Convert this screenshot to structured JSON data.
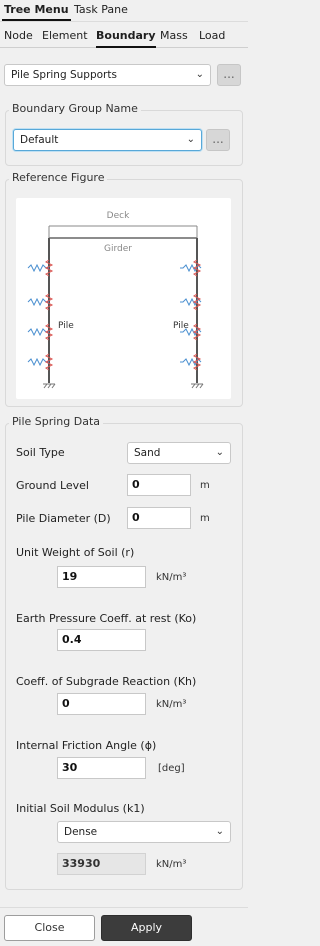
{
  "top_tabs": [
    {
      "label": "Tree Menu",
      "active": true
    },
    {
      "label": "Task Pane",
      "active": false
    }
  ],
  "sub_tabs": [
    {
      "label": "Node",
      "active": false
    },
    {
      "label": "Element",
      "active": false
    },
    {
      "label": "Boundary",
      "active": true
    },
    {
      "label": "Mass",
      "active": false
    },
    {
      "label": "Load",
      "active": false
    }
  ],
  "boundary_type": {
    "value": "Pile Spring Supports",
    "button": "..."
  },
  "boundary_group": {
    "title": "Boundary Group Name",
    "value": "Default",
    "button": "..."
  },
  "reference_figure": {
    "title": "Reference Figure",
    "labels": {
      "deck": "Deck",
      "girder": "Girder",
      "pile_left": "Pile",
      "pile_right": "Pile"
    }
  },
  "pile_spring_data": {
    "title": "Pile Spring Data",
    "soil_type": {
      "label": "Soil Type",
      "value": "Sand"
    },
    "ground_level": {
      "label": "Ground Level",
      "value": "0",
      "unit": "m"
    },
    "pile_diameter": {
      "label": "Pile Diameter (D)",
      "value": "0",
      "unit": "m"
    },
    "unit_weight": {
      "label": "Unit Weight of Soil (r)",
      "value": "19",
      "unit": "kN/m³"
    },
    "earth_pressure": {
      "label": "Earth Pressure Coeff. at rest (Ko)",
      "value": "0.4"
    },
    "subgrade": {
      "label": "Coeff. of Subgrade Reaction (Kh)",
      "value": "0",
      "unit": "kN/m³"
    },
    "friction_angle": {
      "label": "Internal Friction Angle (ϕ)",
      "value": "30",
      "unit": "[deg]"
    },
    "soil_modulus": {
      "label": "Initial Soil Modulus (k1)",
      "option": "Dense",
      "value": "33930",
      "unit": "kN/m³"
    }
  },
  "buttons": {
    "close": "Close",
    "apply": "Apply"
  },
  "colors": {
    "accent": "#58a8d8",
    "spring": "#d9534f",
    "support": "#4a8fd0",
    "apply_bg": "#3c3c3c"
  }
}
